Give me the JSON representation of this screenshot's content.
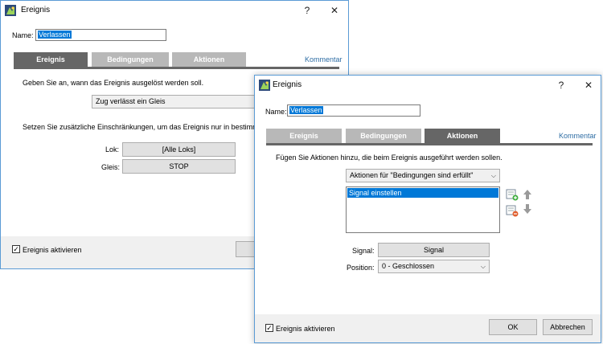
{
  "back_window": {
    "title": "Ereignis",
    "help": "?",
    "close": "✕",
    "name_label": "Name:",
    "name_value": "Verlassen",
    "tabs": [
      "Ereignis",
      "Bedingungen",
      "Aktionen"
    ],
    "kommentar": "Kommentar",
    "instruction": "Geben Sie an, wann das Ereignis ausgelöst werden soll.",
    "trigger_value": "Zug verlässt ein Gleis",
    "restriction": "Setzen Sie zusätzliche Einschränkungen, um das Ereignis nur in bestimmten Si",
    "lok_label": "Lok:",
    "lok_value": "[Alle Loks]",
    "gleis_label": "Gleis:",
    "gleis_value": "STOP",
    "activate_label": "Ereignis aktivieren"
  },
  "front_window": {
    "title": "Ereignis",
    "help": "?",
    "close": "✕",
    "name_label": "Name:",
    "name_value": "Verlassen",
    "tabs": [
      "Ereignis",
      "Bedingungen",
      "Aktionen"
    ],
    "kommentar": "Kommentar",
    "instruction": "Fügen Sie Aktionen hinzu, die beim Ereignis ausgeführt werden sollen.",
    "actions_dropdown": "Aktionen für \"Bedingungen sind erfüllt\"",
    "actions_list": [
      "Signal einstellen"
    ],
    "signal_label": "Signal:",
    "signal_value": "Signal",
    "position_label": "Position:",
    "position_value": "0 - Geschlossen",
    "activate_label": "Ereignis aktivieren",
    "ok": "OK",
    "cancel": "Abbrechen"
  },
  "icons": [
    "app-icon",
    "add-action-icon",
    "remove-action-icon",
    "arrow-up-icon",
    "arrow-down-icon",
    "chevron-down-icon",
    "checkbox-checked-icon"
  ],
  "colors": {
    "accent": "#0078d7",
    "tab_active": "#666666",
    "tab_inactive": "#b8b8b8",
    "link": "#2e6da4"
  }
}
